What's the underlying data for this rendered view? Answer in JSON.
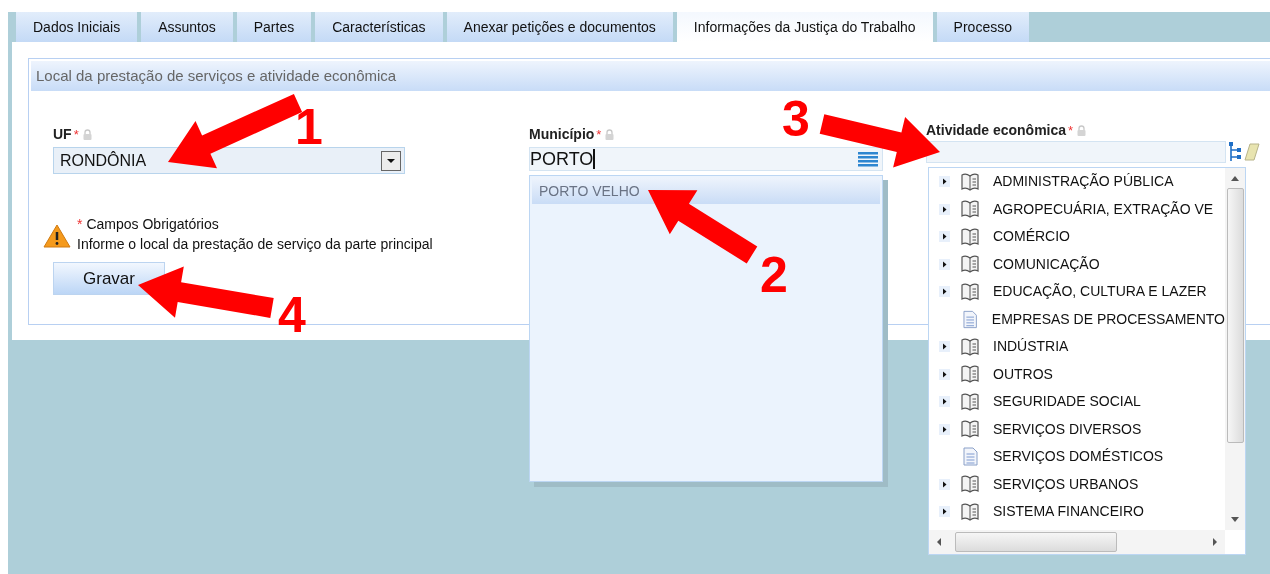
{
  "tabs": [
    {
      "label": "Dados Iniciais",
      "selected": false
    },
    {
      "label": "Assuntos",
      "selected": false
    },
    {
      "label": "Partes",
      "selected": false
    },
    {
      "label": "Características",
      "selected": false
    },
    {
      "label": "Anexar petições e documentos",
      "selected": false
    },
    {
      "label": "Informações da Justiça do Trabalho",
      "selected": true
    },
    {
      "label": "Processo",
      "selected": false
    }
  ],
  "section": {
    "title": "Local da prestação de serviços e atividade econômica"
  },
  "fields": [
    {
      "kind": "select",
      "label": "UF",
      "required_mark": "*",
      "locked": true,
      "value": "RONDÔNIA"
    },
    {
      "kind": "autocomplete",
      "label": "Município",
      "required_mark": "*",
      "locked": true,
      "value": "PORTO",
      "suggestions": [
        {
          "label": "PORTO VELHO",
          "selected": true
        }
      ]
    },
    {
      "kind": "tree",
      "label": "Atividade econômica",
      "required_mark": "*",
      "locked": true,
      "tree_items": [
        {
          "kind": "group",
          "label": "ADMINISTRAÇÃO PÚBLICA"
        },
        {
          "kind": "group",
          "label": "AGROPECUÁRIA, EXTRAÇÃO VE"
        },
        {
          "kind": "group",
          "label": "COMÉRCIO"
        },
        {
          "kind": "group",
          "label": "COMUNICAÇÃO"
        },
        {
          "kind": "group",
          "label": "EDUCAÇÃO, CULTURA E LAZER"
        },
        {
          "kind": "leaf",
          "label": "EMPRESAS DE PROCESSAMENTO"
        },
        {
          "kind": "group",
          "label": "INDÚSTRIA"
        },
        {
          "kind": "group",
          "label": "OUTROS"
        },
        {
          "kind": "group",
          "label": "SEGURIDADE SOCIAL"
        },
        {
          "kind": "group",
          "label": "SERVIÇOS DIVERSOS"
        },
        {
          "kind": "leaf",
          "label": "SERVIÇOS DOMÉSTICOS"
        },
        {
          "kind": "group",
          "label": "SERVIÇOS URBANOS"
        },
        {
          "kind": "group",
          "label": "SISTEMA FINANCEIRO"
        }
      ]
    }
  ],
  "notice": {
    "mark": "*",
    "title": "Campos Obrigatórios",
    "message": "Informe o local da prestação de serviço da parte principal"
  },
  "save_button": "Gravar",
  "annotations": [
    {
      "number": "1"
    },
    {
      "number": "3"
    },
    {
      "number": "2"
    },
    {
      "number": "4"
    }
  ]
}
